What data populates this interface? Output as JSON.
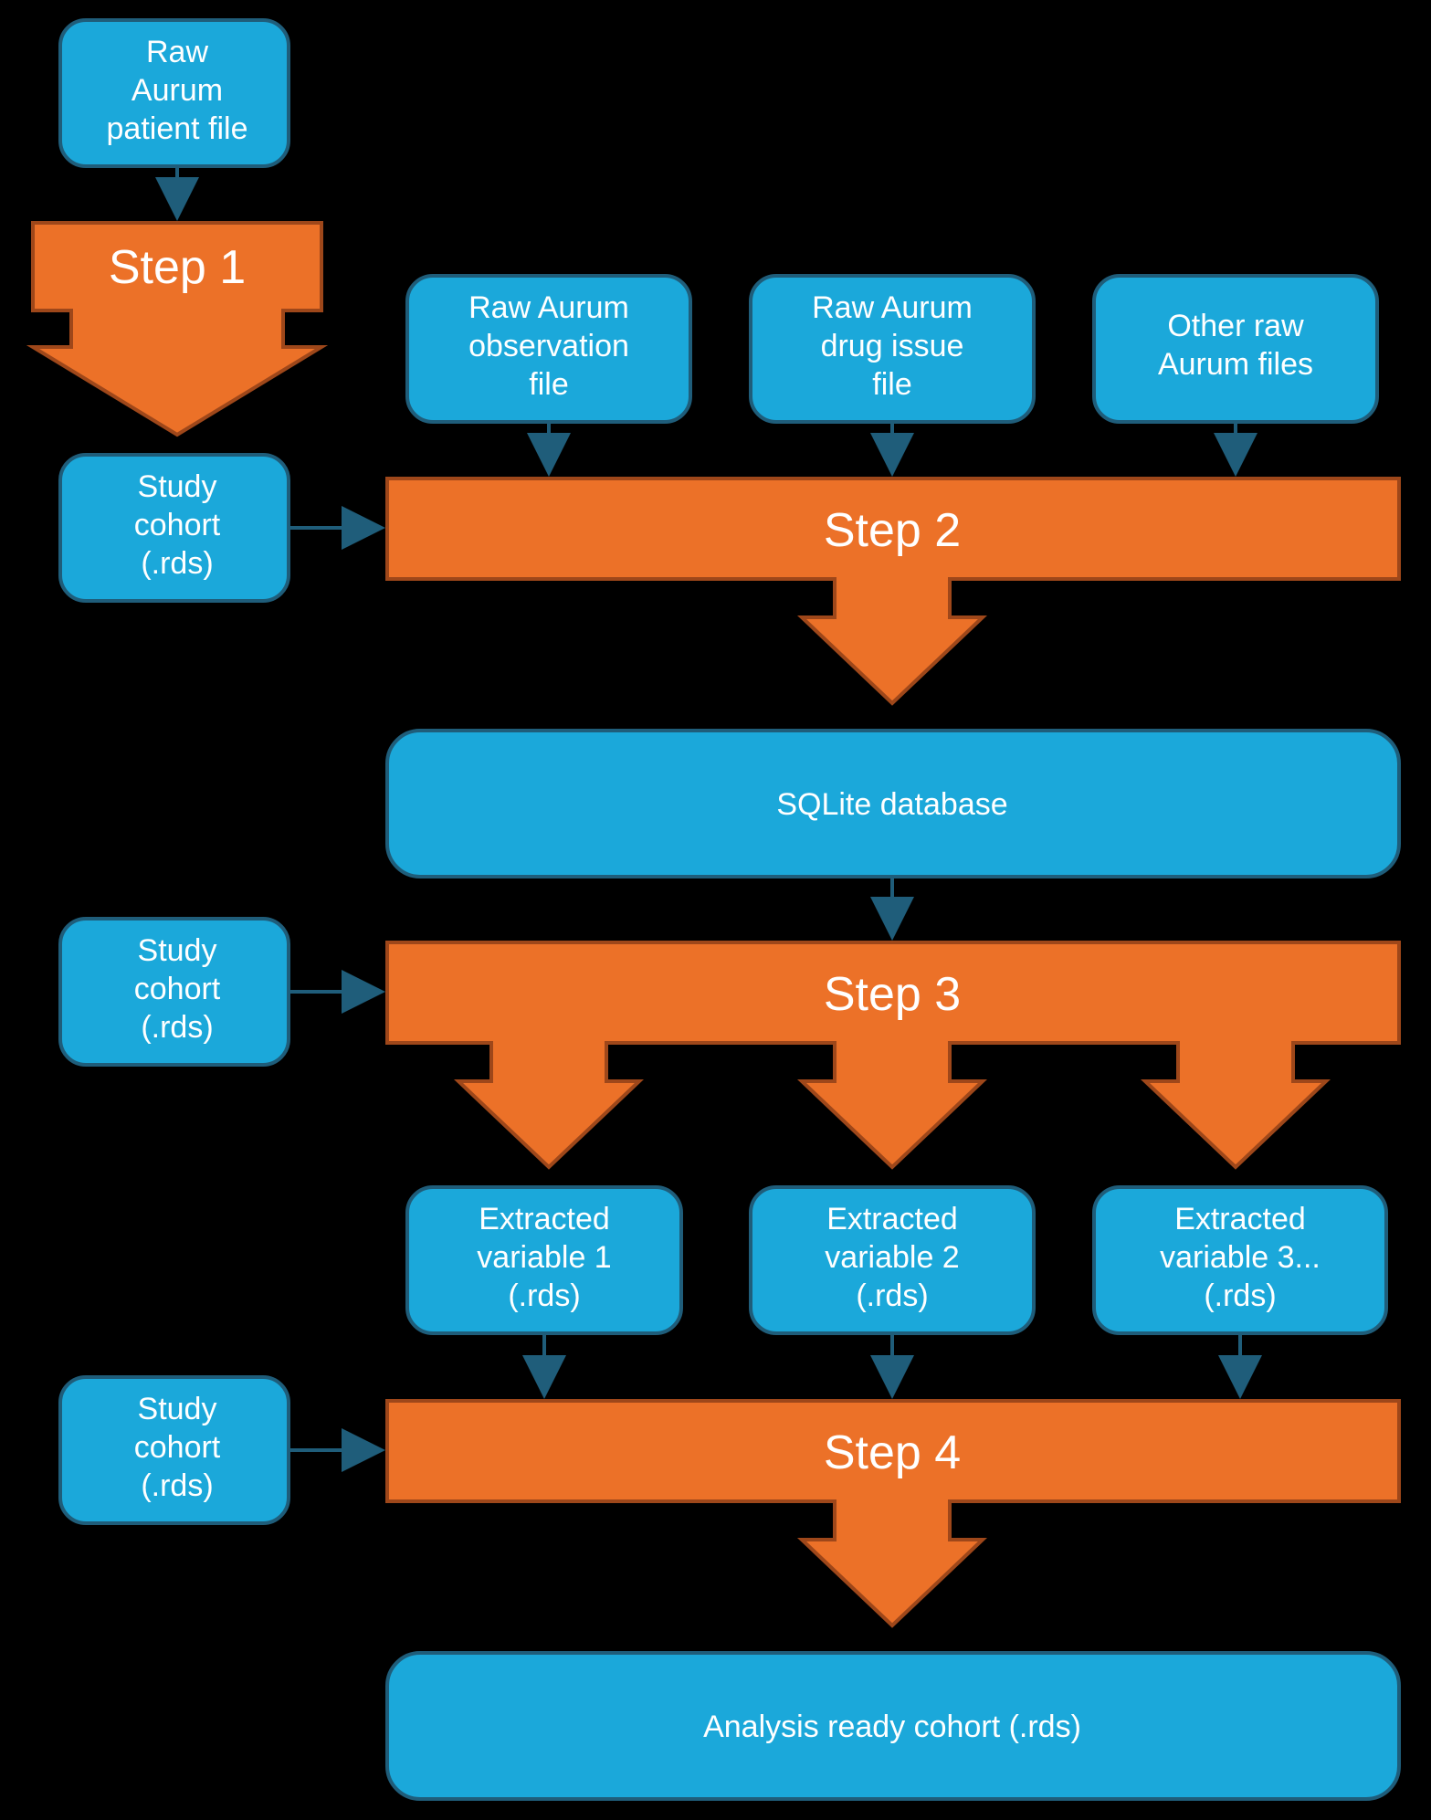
{
  "nodes": {
    "raw_patient": "Raw\nAurum\npatient file",
    "step1": "Step 1",
    "study_cohort_1": "Study\ncohort\n(.rds)",
    "raw_obs": "Raw Aurum\nobservation\nfile",
    "raw_drug": "Raw Aurum\ndrug issue\nfile",
    "raw_other": "Other raw\nAurum files",
    "step2": "Step 2",
    "sqlite": "SQLite database",
    "study_cohort_2": "Study\ncohort\n(.rds)",
    "step3": "Step 3",
    "ext_var_1": "Extracted\nvariable 1\n(.rds)",
    "ext_var_2": "Extracted\nvariable 2\n(.rds)",
    "ext_var_3": "Extracted\nvariable 3...\n(.rds)",
    "study_cohort_3": "Study\ncohort\n(.rds)",
    "step4": "Step 4",
    "analysis_ready": "Analysis ready cohort (.rds)"
  }
}
